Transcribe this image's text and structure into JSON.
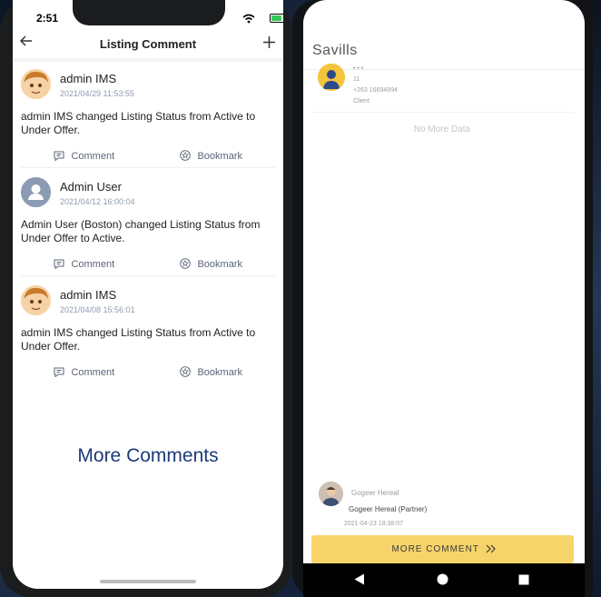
{
  "left_phone": {
    "status": {
      "time": "2:51"
    },
    "nav": {
      "title": "Listing Comment",
      "back_icon": "arrow-left-icon",
      "add_icon": "plus-icon"
    },
    "comments": [
      {
        "author": "admin IMS",
        "date": "2021/04/29 11:53:55",
        "text": "admin IMS changed Listing Status from Active to Under Offer.",
        "avatar": "cartoon-avatar"
      },
      {
        "author": "Admin User",
        "date": "2021/04/12 16:00:04",
        "text": "Admin User (Boston) changed Listing Status from Under Offer to Active.",
        "avatar": "default-user-avatar"
      },
      {
        "author": "admin IMS",
        "date": "2021/04/08 15:56:01",
        "text": "admin IMS changed Listing Status from Active to Under Offer.",
        "avatar": "cartoon-avatar"
      }
    ],
    "actions": {
      "comment_label": "Comment",
      "bookmark_label": "Bookmark"
    },
    "more_comments": "More Comments"
  },
  "right_phone": {
    "title": "Savills",
    "contact": {
      "name": "• • •",
      "line1": "11",
      "phone": "+263 16694994",
      "role": "Client"
    },
    "no_more": "No More Data",
    "latest_comment": {
      "name": "Gogeer Hereal",
      "text": "Gogeer Hereal (Partner)",
      "date": "2021-04-23 18:38:07"
    },
    "more_button": "MORE COMMENT",
    "more_button_icon": "double-chevron-right-icon",
    "nav_icons": [
      "back-triangle-icon",
      "home-circle-icon",
      "recents-square-icon"
    ]
  }
}
